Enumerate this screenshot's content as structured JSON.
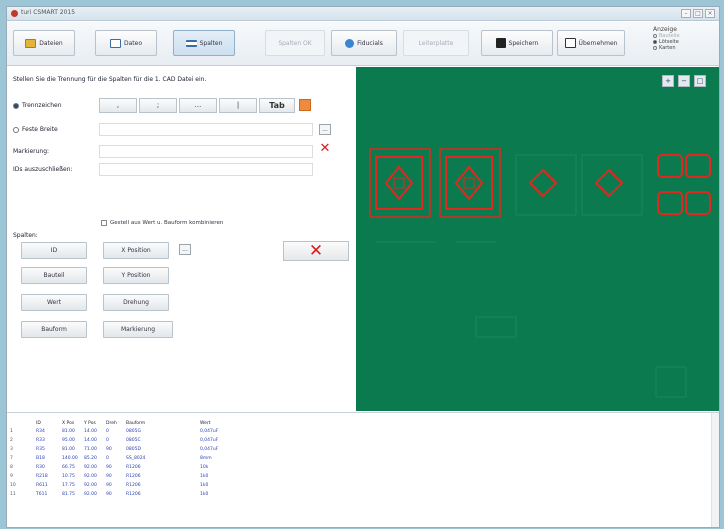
{
  "window": {
    "title": "turi CSMART 2015",
    "controls": [
      "–",
      "□",
      "×"
    ]
  },
  "toolbar": {
    "buttons": [
      {
        "label": "Dateien",
        "icon": "folder-icon"
      },
      {
        "label": "Dateo",
        "icon": "file-icon"
      },
      {
        "label": "Spalten",
        "icon": "columns-icon"
      },
      {
        "label": "Spalten OK",
        "icon": ""
      },
      {
        "label": "Fiducials",
        "icon": "fiducial-icon"
      },
      {
        "label": "Leiterplatte",
        "icon": ""
      },
      {
        "label": "Speichern",
        "icon": "save-icon"
      },
      {
        "label": "Übernehmen",
        "icon": "apply-icon"
      }
    ],
    "anzeige": {
      "title": "Anzeige",
      "options": [
        "Bauteile",
        "Lötseite",
        "Karten"
      ]
    }
  },
  "form": {
    "instruction": "Stellen Sie die Trennung für die Spalten für die 1. CAD Datei ein.",
    "separator_label": "Trennzeichen",
    "separators": [
      ",",
      ";",
      "...",
      "|",
      "Tab"
    ],
    "fixed_width_label": "Feste Breite",
    "marker_label": "Markierung:",
    "exclude_label": "IDs auszuschließen:",
    "merge_label": "Gestell aus Wert u. Bauform kombinieren",
    "columns_label": "Spalten:",
    "column_buttons": [
      "ID",
      "X Position",
      "Bauteil",
      "Y Position",
      "Wert",
      "Drehung",
      "Bauform",
      "Markierung"
    ],
    "small_button": "..."
  },
  "canvas": {
    "zoom_buttons": [
      "+",
      "−",
      "□"
    ]
  },
  "table": {
    "headers": [
      "",
      "ID",
      "X Pos",
      "Y Pos",
      "Dreh",
      "Bauform",
      "Wert"
    ],
    "rows": [
      [
        "1",
        "R34",
        "81.00",
        "14.00",
        "0",
        "0805G",
        "0,047uF"
      ],
      [
        "2",
        "R33",
        "95.00",
        "14.00",
        "0",
        "0805C",
        "0,047uF"
      ],
      [
        "3",
        "R35",
        "81.00",
        "71.00",
        "90",
        "0805D",
        "0,047uF"
      ],
      [
        "7",
        "B18",
        "140.00",
        "85.20",
        "0",
        "SS_8024",
        "8mm"
      ],
      [
        "8",
        "R30",
        "66.75",
        "92.00",
        "90",
        "R1206",
        "10k"
      ],
      [
        "9",
        "R218",
        "10.75",
        "92.00",
        "90",
        "R1206",
        "1k0"
      ],
      [
        "10",
        "R611",
        "17.75",
        "92.00",
        "90",
        "R1206",
        "1k0"
      ],
      [
        "11",
        "T611",
        "81.75",
        "92.00",
        "90",
        "R1206",
        "1k0"
      ]
    ]
  }
}
